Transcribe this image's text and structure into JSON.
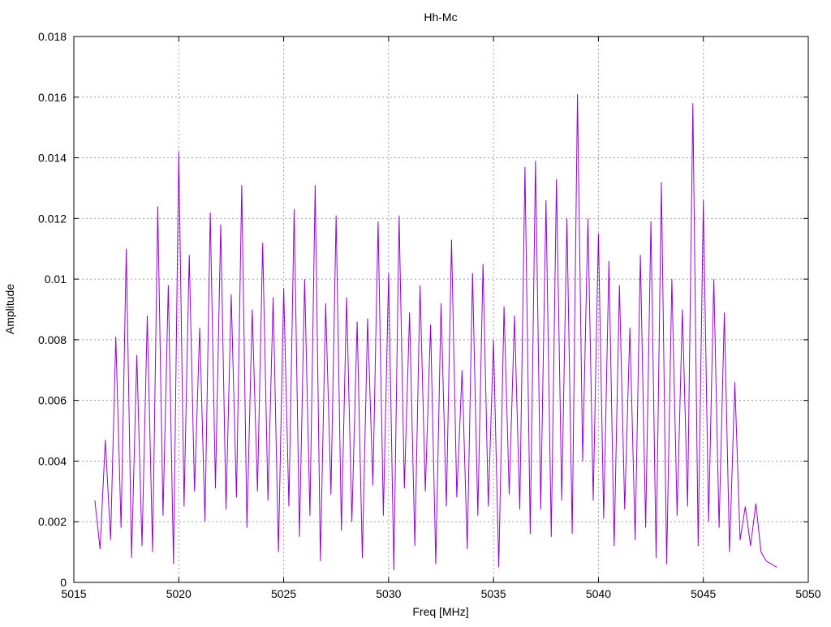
{
  "chart_data": {
    "type": "line",
    "title": "Hh-Mc",
    "xlabel": "Freq [MHz]",
    "ylabel": "Amplitude",
    "xlim": [
      5015,
      5050
    ],
    "ylim": [
      0,
      0.018
    ],
    "xticks": [
      "5015",
      "5020",
      "5025",
      "5030",
      "5035",
      "5040",
      "5045",
      "5050"
    ],
    "yticks": [
      "0",
      "0.002",
      "0.004",
      "0.006",
      "0.008",
      "0.01",
      "0.012",
      "0.014",
      "0.016",
      "0.018"
    ],
    "grid": true,
    "color": "#9400d3",
    "series": [
      {
        "name": "Hh-Mc",
        "x_start": 5016,
        "x_step": 0.25,
        "values": [
          0.0027,
          0.0011,
          0.0047,
          0.0014,
          0.0081,
          0.0018,
          0.011,
          0.0008,
          0.0075,
          0.0012,
          0.0088,
          0.001,
          0.0124,
          0.0022,
          0.0098,
          0.0006,
          0.0142,
          0.0025,
          0.0108,
          0.003,
          0.0084,
          0.002,
          0.0122,
          0.0031,
          0.0118,
          0.0024,
          0.0095,
          0.0028,
          0.0131,
          0.0018,
          0.009,
          0.003,
          0.0112,
          0.0027,
          0.0094,
          0.001,
          0.0097,
          0.0025,
          0.0123,
          0.0015,
          0.01,
          0.0022,
          0.0131,
          0.0007,
          0.0092,
          0.0029,
          0.0121,
          0.0017,
          0.0094,
          0.002,
          0.0086,
          0.0008,
          0.0087,
          0.0032,
          0.0119,
          0.0022,
          0.0102,
          0.0004,
          0.0121,
          0.0031,
          0.0089,
          0.0012,
          0.0098,
          0.003,
          0.0085,
          0.0006,
          0.0092,
          0.0025,
          0.0113,
          0.0028,
          0.007,
          0.0011,
          0.0102,
          0.0022,
          0.0105,
          0.0025,
          0.008,
          0.0005,
          0.0091,
          0.0029,
          0.0088,
          0.0024,
          0.0137,
          0.0016,
          0.0139,
          0.0024,
          0.0126,
          0.0015,
          0.0133,
          0.0027,
          0.012,
          0.0016,
          0.0161,
          0.004,
          0.012,
          0.0027,
          0.0115,
          0.0021,
          0.0106,
          0.0012,
          0.0098,
          0.0024,
          0.0084,
          0.0014,
          0.0108,
          0.0018,
          0.0119,
          0.0008,
          0.0132,
          0.0006,
          0.01,
          0.0022,
          0.009,
          0.0025,
          0.0158,
          0.0012,
          0.0126,
          0.002,
          0.01,
          0.0018,
          0.0089,
          0.001,
          0.0066,
          0.0014,
          0.0025,
          0.0012,
          0.0026,
          0.001,
          0.0007,
          0.0006,
          0.0005
        ]
      }
    ]
  }
}
